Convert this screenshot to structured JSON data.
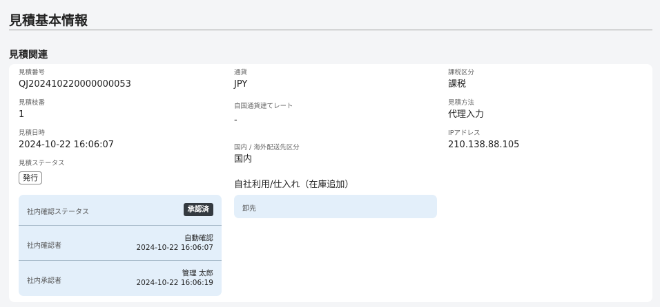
{
  "header": {
    "title": "見積基本情報"
  },
  "section": {
    "title": "見積関連"
  },
  "col1": {
    "quote_number": {
      "label": "見積番号",
      "value": "QJ202410220000000053"
    },
    "quote_branch": {
      "label": "見積枝番",
      "value": "1"
    },
    "quote_datetime": {
      "label": "見積日時",
      "value": "2024-10-22 16:06:07"
    },
    "quote_status": {
      "label": "見積ステータス",
      "value": "発行"
    }
  },
  "internal_panel": {
    "status": {
      "label": "社内確認ステータス",
      "badge": "承認済"
    },
    "confirmer": {
      "label": "社内確認者",
      "name": "自動確認",
      "datetime": "2024-10-22 16:06:07"
    },
    "approver": {
      "label": "社内承認者",
      "name": "管理 太郎",
      "datetime": "2024-10-22 16:06:19"
    }
  },
  "col2": {
    "currency": {
      "label": "通貨",
      "value": "JPY"
    },
    "home_rate": {
      "label": "自国通貨建てレート",
      "value": "-"
    },
    "delivery_type": {
      "label": "国内 / 海外配送先区分",
      "value": "国内"
    },
    "usage_heading": "自社利用/仕入れ（在庫追加）",
    "wholesaler_label": "卸先"
  },
  "col3": {
    "tax_class": {
      "label": "課税区分",
      "value": "課税"
    },
    "quote_method": {
      "label": "見積方法",
      "value": "代理入力"
    },
    "ip_address": {
      "label": "IPアドレス",
      "value": "210.138.88.105"
    }
  }
}
